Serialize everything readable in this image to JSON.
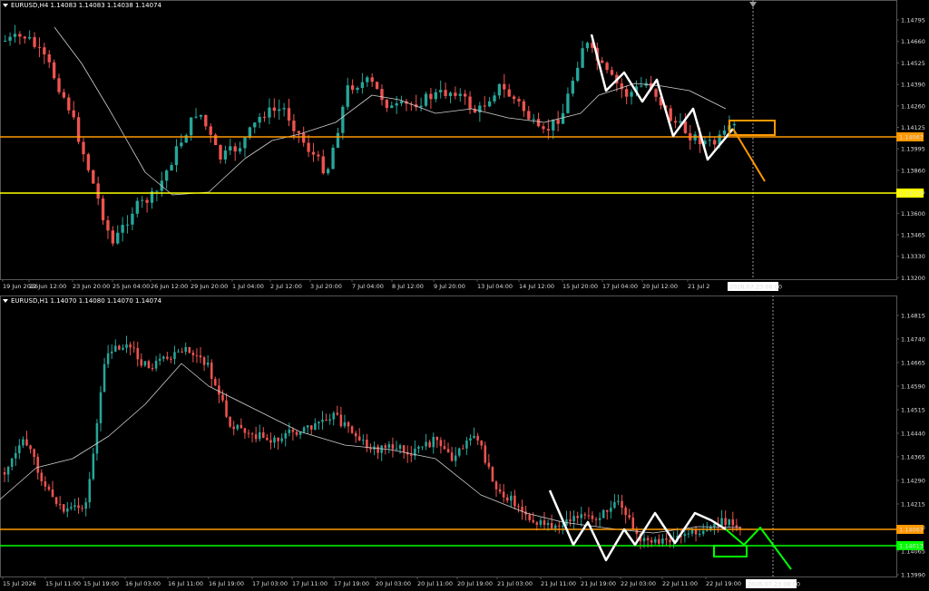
{
  "colors": {
    "bull": "#26a69a",
    "bear": "#ef5350",
    "orange": "#ff9900",
    "yellow": "#ffff00",
    "green": "#00ff00",
    "white": "#ffffff",
    "ma": "#d0d0d0",
    "grid": "#555555",
    "axis_text": "#dddddd"
  },
  "top": {
    "header": "EURUSD,H4  1.14083 1.14083 1.14038 1.14074",
    "price_labels": [
      "1.14795",
      "1.14660",
      "1.14525",
      "1.14390",
      "1.14260",
      "1.14125",
      "1.13995",
      "1.13860",
      "1.13725",
      "1.13600",
      "1.13465",
      "1.13330",
      "1.13200"
    ],
    "time_labels": [
      "19 Jun 2026",
      "22 Jun 12:00",
      "23 Jun 20:00",
      "25 Jun 04:00",
      "26 Jun 12:00",
      "29 Jun 20:00",
      "1 Jul 04:00",
      "2 Jul 12:00",
      "3 Jul 20:00",
      "7 Jul 04:00",
      "8 Jul 12:00",
      "9 Jul 20:00",
      "13 Jul 04:00",
      "14 Jul 12:00",
      "15 Jul 20:00",
      "17 Jul 04:00",
      "20 Jul 12:00",
      "21 Jul 2"
    ],
    "cursor_time": "2026.07.23 08:00",
    "orange_line_label": "1.14067",
    "yellow_line_label": "1.13725",
    "ylim": [
      1.1313,
      1.1487
    ]
  },
  "bottom": {
    "header": "EURUSD,H1  1.14070 1.14080 1.14070 1.14074",
    "price_labels": [
      "1.14815",
      "1.14740",
      "1.14665",
      "1.14590",
      "1.14515",
      "1.14440",
      "1.14365",
      "1.14290",
      "1.14215",
      "1.14140",
      "1.14065",
      "1.13990"
    ],
    "time_labels": [
      "15 Jul 2026",
      "15 Jul 11:00",
      "15 Jul 19:00",
      "16 Jul 03:00",
      "16 Jul 11:00",
      "16 Jul 19:00",
      "17 Jul 03:00",
      "17 Jul 11:00",
      "17 Jul 19:00",
      "20 Jul 03:00",
      "20 Jul 11:00",
      "20 Jul 19:00",
      "21 Jul 03:00",
      "21 Jul 11:00",
      "21 Jul 19:00",
      "22 Jul 03:00",
      "22 Jul 11:00",
      "22 Jul 19:00"
    ],
    "cursor_time": "2026.07.23 08:00",
    "orange_line_label": "1.14067",
    "green_line_label": "1.14013",
    "ylim": [
      1.13945,
      1.1485
    ]
  }
}
